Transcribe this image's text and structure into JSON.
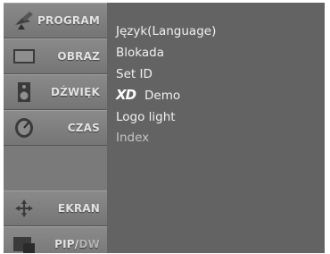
{
  "sidebar": {
    "items": [
      {
        "label": "PROGRAM",
        "icon": "satellite-dish-icon"
      },
      {
        "label": "OBRAZ",
        "icon": "picture-icon"
      },
      {
        "label": "DŹWIĘK",
        "icon": "speaker-icon"
      },
      {
        "label": "CZAS",
        "icon": "clock-icon"
      },
      {
        "label": "EKRAN",
        "icon": "screen-adjust-icon"
      },
      {
        "label_main": "PIP/",
        "label_dim": "DW",
        "icon": "pip-icon"
      }
    ]
  },
  "menu": {
    "items": [
      {
        "label": "Język(Language)"
      },
      {
        "label": "Blokada"
      },
      {
        "label": "Set ID"
      },
      {
        "logo": "XD",
        "label": "Demo"
      },
      {
        "label": "Logo light"
      },
      {
        "label": "Index"
      }
    ]
  }
}
